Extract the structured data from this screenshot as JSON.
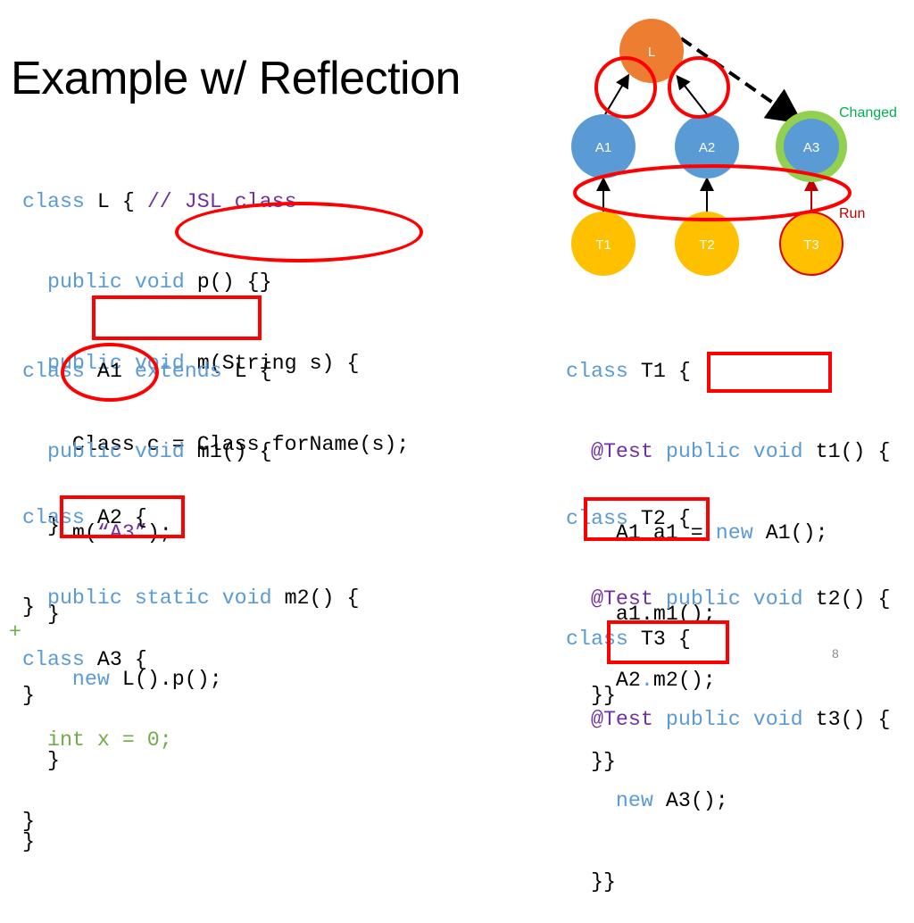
{
  "slide": {
    "title": "Example w/ Reflection",
    "page_number": "8"
  },
  "colors": {
    "keyword": "#5b9bd5",
    "comment": "#7030a0",
    "added_line": "#70ad47",
    "highlight": "#ff0000",
    "node_L": "#ed7d31",
    "node_A": "#5b9bd5",
    "node_T": "#ffc000",
    "changed_ring": "#92d050",
    "changed_label": "#00b050",
    "run_label": "#c00000"
  },
  "left_code": {
    "L": {
      "line1": {
        "kw": "class",
        "name": " L { ",
        "comment": "// JSL class"
      },
      "line2": {
        "kw": "public void",
        "rest": " p() {}"
      },
      "line3": {
        "kw": "public void",
        "rest": " m(String s) {"
      },
      "line4": "Class c = Class.forName(s);",
      "line5": "}",
      "line6": "}"
    },
    "A1": {
      "line1": {
        "kw": "class",
        "name": " A1 ",
        "kw2": "extends",
        "rest": " L {"
      },
      "line2": {
        "kw": "public void",
        "rest": " m1() {"
      },
      "line3": {
        "pre": "m(",
        "str": "“A3”",
        "post": ");"
      },
      "line4": "}",
      "line5": "}"
    },
    "A2": {
      "line1": {
        "kw": "class",
        "rest": " A2 {"
      },
      "line2": {
        "kw": "public static void",
        "rest": " m2() {"
      },
      "line3": {
        "kw": "new",
        "rest": " L().p();"
      },
      "line4": "}",
      "line5": "}"
    },
    "A3": {
      "line1": {
        "kw": "class",
        "rest": " A3 {"
      },
      "line2": {
        "marker": "+",
        "code": "int x = 0;"
      },
      "line3": "}"
    }
  },
  "right_code": {
    "T1": {
      "line1": {
        "kw": "class",
        "rest": " T1 {"
      },
      "line2": {
        "ann": "@Test",
        "kw": " public void",
        "rest": " t1() {"
      },
      "line3": {
        "pre": "A1 a1 = ",
        "kw": "new",
        "rest": " A1();"
      },
      "line4": "a1.m1();",
      "line5": "}}"
    },
    "T2": {
      "line1": {
        "kw": "class",
        "rest": " T2 {"
      },
      "line2": {
        "ann": "@Test",
        "kw": " public void",
        "rest": " t2() {"
      },
      "line3": {
        "pre": "A2",
        "dot": ".",
        "rest": "m2();"
      },
      "line4": "}}"
    },
    "T3": {
      "line1": {
        "kw": "class",
        "rest": " T3 {"
      },
      "line2": {
        "ann": "@Test",
        "kw": " public void",
        "rest": " t3() {"
      },
      "line3": {
        "kw": "new",
        "rest": " A3();"
      },
      "line4": "}}"
    }
  },
  "diagram": {
    "nodes": [
      {
        "id": "L",
        "label": "L",
        "kind": "library"
      },
      {
        "id": "A1",
        "label": "A1",
        "kind": "class"
      },
      {
        "id": "A2",
        "label": "A2",
        "kind": "class"
      },
      {
        "id": "A3",
        "label": "A3",
        "kind": "class",
        "changed": true
      },
      {
        "id": "T1",
        "label": "T1",
        "kind": "test"
      },
      {
        "id": "T2",
        "label": "T2",
        "kind": "test"
      },
      {
        "id": "T3",
        "label": "T3",
        "kind": "test",
        "selected": true
      }
    ],
    "edges": [
      {
        "from": "A1",
        "to": "L",
        "style": "solid",
        "highlighted": true
      },
      {
        "from": "A2",
        "to": "L",
        "style": "solid",
        "highlighted": true
      },
      {
        "from": "L",
        "to": "A3",
        "style": "dashed"
      },
      {
        "from": "T1",
        "to": "A1",
        "style": "solid"
      },
      {
        "from": "T2",
        "to": "A2",
        "style": "solid"
      },
      {
        "from": "T3",
        "to": "A3",
        "style": "solid",
        "color": "red"
      }
    ],
    "labels": {
      "changed": "Changed",
      "run": "Run"
    }
  }
}
